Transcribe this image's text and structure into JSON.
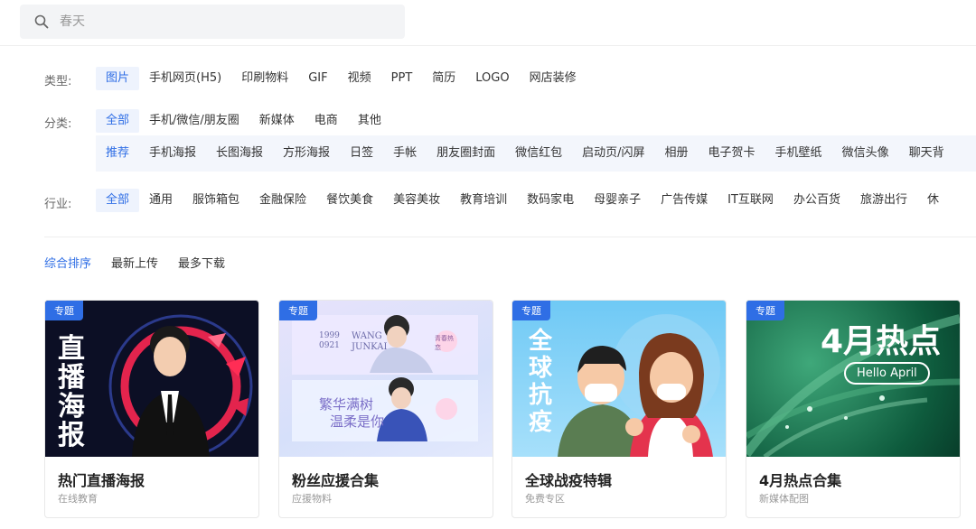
{
  "search": {
    "placeholder": "春天"
  },
  "filters": {
    "type": {
      "label": "类型:",
      "options": [
        "图片",
        "手机网页(H5)",
        "印刷物料",
        "GIF",
        "视频",
        "PPT",
        "简历",
        "LOGO",
        "网店装修"
      ]
    },
    "category": {
      "label": "分类:",
      "options": [
        "全部",
        "手机/微信/朋友圈",
        "新媒体",
        "电商",
        "其他"
      ]
    },
    "subcategory": {
      "options": [
        "推荐",
        "手机海报",
        "长图海报",
        "方形海报",
        "日签",
        "手帐",
        "朋友圈封面",
        "微信红包",
        "启动页/闪屏",
        "相册",
        "电子贺卡",
        "手机壁纸",
        "微信头像",
        "聊天背"
      ]
    },
    "industry": {
      "label": "行业:",
      "options": [
        "全部",
        "通用",
        "服饰箱包",
        "金融保险",
        "餐饮美食",
        "美容美妆",
        "教育培训",
        "数码家电",
        "母婴亲子",
        "广告传媒",
        "IT互联网",
        "办公百货",
        "旅游出行",
        "休"
      ]
    }
  },
  "sort": {
    "options": [
      "综合排序",
      "最新上传",
      "最多下载"
    ]
  },
  "cards": [
    {
      "badge": "专题",
      "title": "热门直播海报",
      "subtitle": "在线教育",
      "art": [
        "直",
        "播",
        "海",
        "报"
      ]
    },
    {
      "badge": "专题",
      "title": "粉丝应援合集",
      "subtitle": "应援物料",
      "art": {
        "year1": "1999",
        "year2": "0921",
        "name1": "WANG",
        "name2": "JUNKAI",
        "slogan1": "繁华满树",
        "slogan2": "温柔是你",
        "stamp": "青春热恋"
      }
    },
    {
      "badge": "专题",
      "title": "全球战疫特辑",
      "subtitle": "免费专区",
      "art": [
        "全",
        "球",
        "抗",
        "疫"
      ]
    },
    {
      "badge": "专题",
      "title": "4月热点合集",
      "subtitle": "新媒体配图",
      "art": {
        "big": "4月热点",
        "pill": "Hello April"
      }
    }
  ],
  "colors": {
    "accent": "#2f6ee5",
    "activeBg": "#eef3fd"
  }
}
